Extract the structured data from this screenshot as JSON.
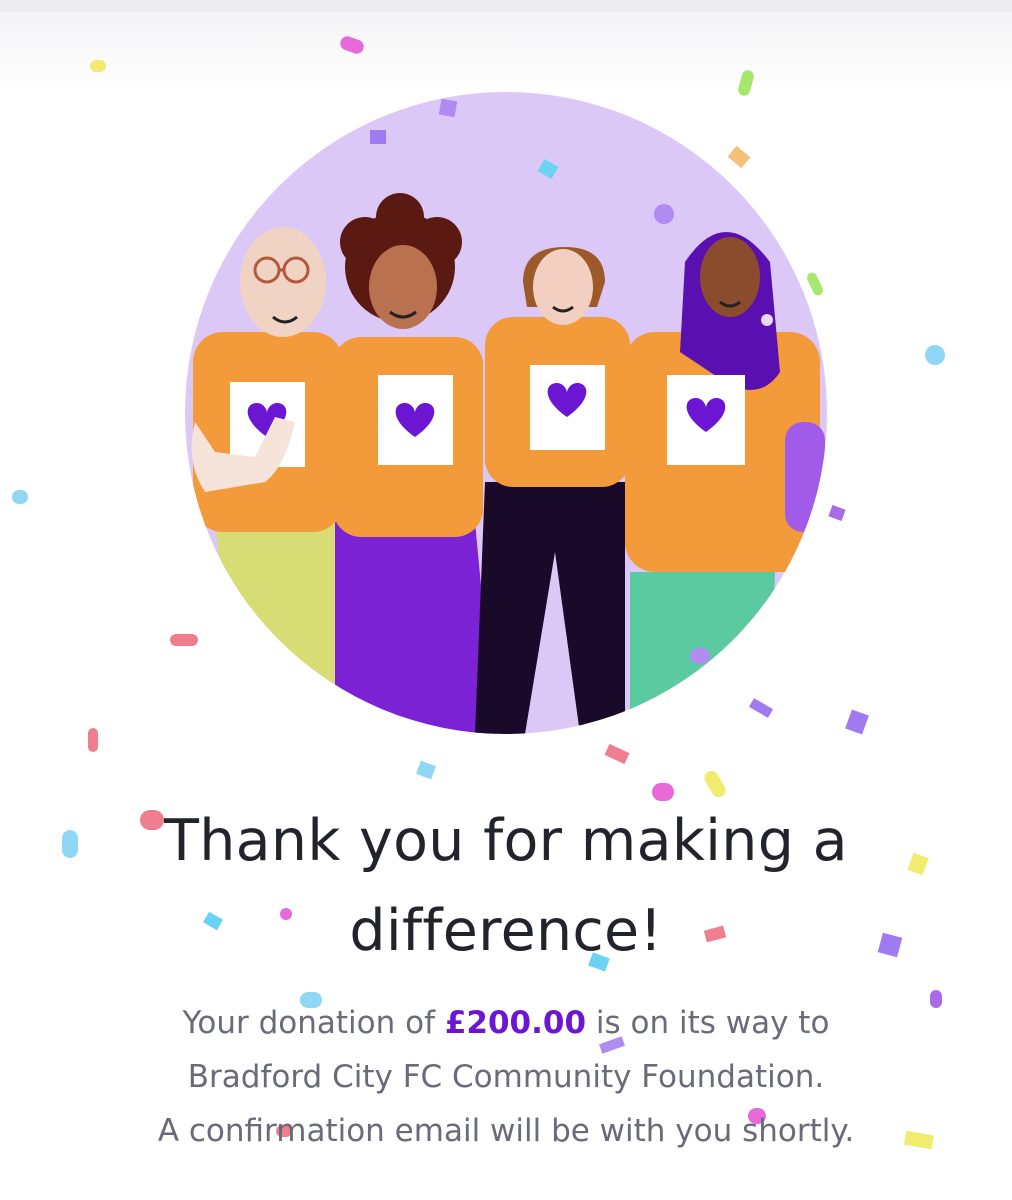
{
  "colors": {
    "accent": "#6c16d4",
    "heading": "#22232b",
    "body_text": "#6a6b78",
    "illustration_bg": "#dcc8f7",
    "shirt": "#f39a3a",
    "heart": "#6c16d4"
  },
  "illustration": {
    "name": "people-celebrating-illustration"
  },
  "confirmation": {
    "heading": "Thank you for making a difference!",
    "line1_prefix": "Your donation of ",
    "amount": "£200.00",
    "line1_suffix": " is on its way to",
    "line2": "Bradford City FC Community Foundation.",
    "line3": "A confirmation email will be with you shortly."
  }
}
